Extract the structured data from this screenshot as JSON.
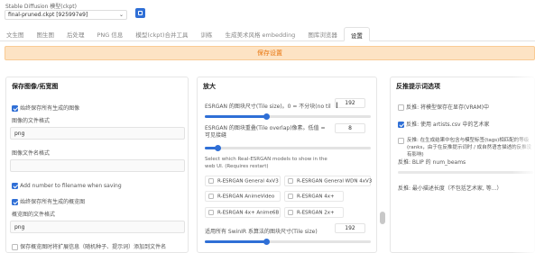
{
  "model": {
    "label": "Stable Diffusion 模型(ckpt)",
    "value": "final-pruned.ckpt [925997e9]"
  },
  "tabs": [
    {
      "label": "文生图",
      "active": false
    },
    {
      "label": "图生图",
      "active": false
    },
    {
      "label": "后处理",
      "active": false
    },
    {
      "label": "PNG 信息",
      "active": false
    },
    {
      "label": "模型(ckpt)合并工具",
      "active": false
    },
    {
      "label": "训练",
      "active": false
    },
    {
      "label": "生成美术风格 embedding",
      "active": false
    },
    {
      "label": "图库浏览器",
      "active": false
    },
    {
      "label": "设置",
      "active": true
    }
  ],
  "apply_button": "保存设置",
  "left": {
    "title": "保存图像/拓宽图",
    "save_all": {
      "label": "始终保存所有生成的图像",
      "checked": true
    },
    "file_format_label": "图像的文件格式",
    "file_format_value": "png",
    "filename_pattern_label": "图像文件名格式",
    "filename_pattern_value": "",
    "add_number": {
      "label": "Add number to filename when saving",
      "checked": true
    },
    "save_grids": {
      "label": "始终保存所有生成的概览图",
      "checked": true
    },
    "grid_format_label": "概览图的文件格式",
    "grid_format_value": "png",
    "save_extended": {
      "label": "保存概览图时将扩展信息（随机种子、提示词）添加到文件名",
      "checked": false
    }
  },
  "mid": {
    "title": "放大",
    "tile_size_label": "ESRGAN 的图块尺寸(Tile size)。0 = 不分块(no tiling)",
    "tile_size_value": "192",
    "tile_size_fraction": 0.37,
    "tile_overlap_label": "ESRGAN 的图块重叠(Tile overlap)像素。低值 = 可见接缝",
    "tile_overlap_value": "8",
    "tile_overlap_fraction": 0.08,
    "models_label": "Select which Real-ESRGAN models to show in the web UI. (Requires restart)",
    "upscalers": [
      {
        "label": "R-ESRGAN General 4xV3",
        "checked": false
      },
      {
        "label": "R-ESRGAN General WDN 4xV3",
        "checked": false
      },
      {
        "label": "R-ESRGAN AnimeVideo",
        "checked": false
      },
      {
        "label": "R-ESRGAN 4x+",
        "checked": false
      },
      {
        "label": "R-ESRGAN 4x+ Anime6B",
        "checked": false
      },
      {
        "label": "R-ESRGAN 2x+",
        "checked": false
      }
    ],
    "swinir_label": "适用所有 SwinIR 系算法的图块尺寸(Tile size)",
    "swinir_value": "192",
    "swinir_fraction": 0.37
  },
  "right": {
    "title": "反推提示词选项",
    "keep_vram": {
      "label": "反推: 将模型保存在显存(VRAM)中",
      "checked": false
    },
    "use_artists": {
      "label": "反推: 使用 artists.csv 中的艺术家",
      "checked": true
    },
    "include_ranks": {
      "label": "反推: 在生成结果中包含与模型标签(tags)相匹配的等级(ranks，由于在反推提示词时 / 成自然语言描述的反推没有影响)",
      "checked": false
    },
    "beams_label": "反推: BLIP 的 num_beams",
    "min_length_label": "反推: 最小描述长度（不包括艺术家, 等...）"
  }
}
